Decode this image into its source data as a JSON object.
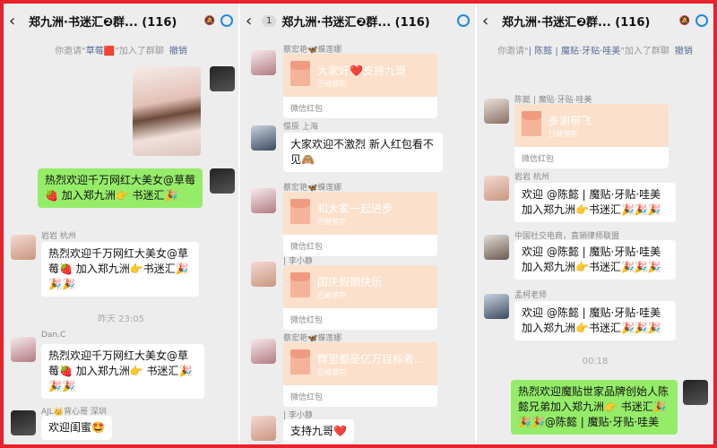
{
  "group_title": "郑九洲·书迷汇❷群...",
  "member_count": "(116)",
  "mute_icon": "🔕",
  "panel2_unread": "1",
  "red_packet_footer": "微信红包",
  "red_packet_state": "已被领完",
  "panels": [
    {
      "system_notice": {
        "prefix": "你邀请\"",
        "name": "草莓🟥",
        "suffix": "\"加入了群聊",
        "undo": "撤销"
      },
      "messages": [
        {
          "text": "热烈欢迎千万网红大美女@草莓🍓 加入郑九洲👉 书迷汇🎉"
        },
        {
          "sender": "岩岩 杭州",
          "text": "热烈欢迎千万网红大美女@草莓🍓 加入郑九洲👉书迷汇🎉🎉🎉"
        },
        {
          "sender": "Dan.C",
          "text": "热烈欢迎千万网红大美女@草莓🍓 加入郑九洲👉 书迷汇🎉🎉🎉"
        },
        {
          "sender": "AJL👑背心哥 深圳",
          "text": "欢迎闺蜜🤩"
        }
      ],
      "time_divider": "昨天 23:05"
    },
    {
      "messages": [
        {
          "sender": "蔡宏艳🦋蝶莲娜",
          "wish": "大家好❤️支持九哥"
        },
        {
          "sender": "憬原 上海",
          "text": "大家欢迎不激烈 新人红包看不见🙈"
        },
        {
          "sender": "蔡宏艳🦋蝶莲娜",
          "wish": "和大家一起进步"
        },
        {
          "sender": "| 李小静",
          "wish": "国庆假期快乐"
        },
        {
          "sender": "蔡宏艳🦋蝶莲娜",
          "wish": "群里都是亿万目标者..."
        },
        {
          "sender": "| 李小静",
          "text": "支持九哥❤️"
        }
      ]
    },
    {
      "system_notice": {
        "prefix": "你邀请\"",
        "name": "| 陈懿 | 魔贴·牙贴·哇美",
        "suffix": "\"加入了群聊",
        "undo": "撤销"
      },
      "messages": [
        {
          "sender": "陈懿 | 魔贴·牙贴·哇美",
          "wish": "多谢带飞"
        },
        {
          "sender": "岩岩 杭州",
          "text": "欢迎 @陈懿 | 魔贴·牙贴·哇美 加入郑九洲👉书迷汇🎉🎉🎉"
        },
        {
          "sender": "中国社交电商，直销律师联盟",
          "text": "欢迎 @陈懿 | 魔贴·牙贴·哇美 加入郑九洲👉书迷汇🎉🎉🎉"
        },
        {
          "sender": "孟柯老师",
          "text": "欢迎 @陈懿 | 魔贴·牙贴·哇美 加入郑九洲👉书迷汇🎉🎉🎉"
        },
        {
          "text": "热烈欢迎魔贴世家品牌创始人陈懿兄弟加入郑九洲👉 书迷汇🎉🎉🎉@陈懿 | 魔贴·牙贴·哇美"
        }
      ],
      "time_divider": "00:18"
    }
  ]
}
